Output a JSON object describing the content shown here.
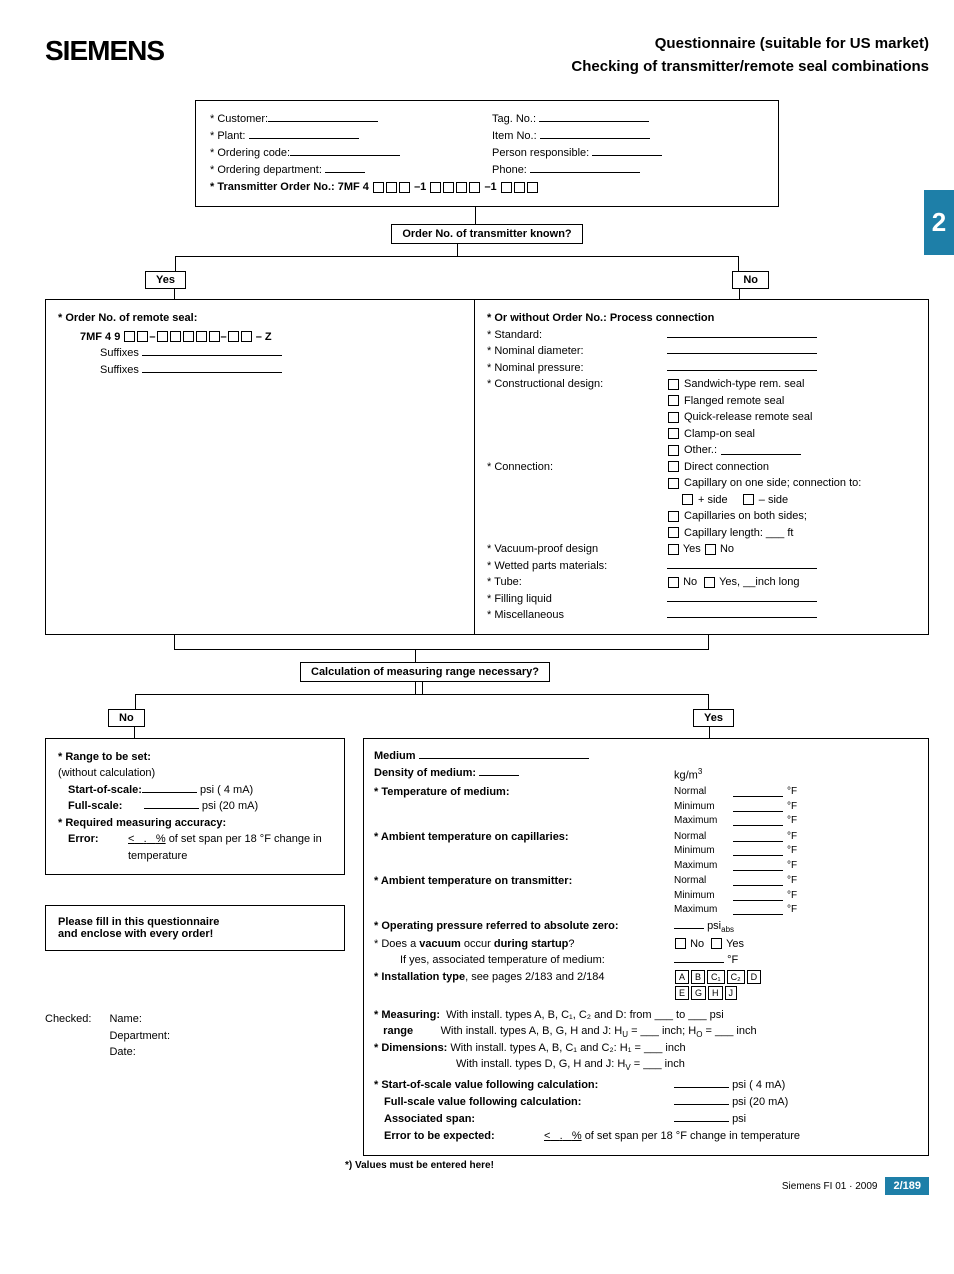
{
  "logo": "SIEMENS",
  "header": {
    "line1": "Questionnaire (suitable for US market)",
    "line2": "Checking of transmitter/remote seal combinations"
  },
  "sidetab": "2",
  "top": {
    "customer": "* Customer:",
    "tagno": "Tag. No.:",
    "plant": "* Plant:",
    "itemno": "Item No.:",
    "ordcode": "* Ordering code:",
    "person": "Person responsible:",
    "orddept": "* Ordering department:",
    "phone": "Phone:",
    "transno": "* Transmitter Order No.:  7MF 4",
    "dash1": "–1",
    "dash1b": "–1"
  },
  "q1": "Order No. of transmitter known?",
  "yes": "Yes",
  "no": "No",
  "left1": {
    "title": "* Order No. of remote seal:",
    "orderno": "7MF 4 9",
    "dashz": "– Z",
    "suffixes": "Suffixes"
  },
  "right1": {
    "title": "*  Or without Order No.: Process connection",
    "standard": "* Standard:",
    "nomdia": "* Nominal diameter:",
    "nompres": "* Nominal pressure:",
    "constr": "* Constructional design:",
    "c1": "Sandwich-type rem. seal",
    "c2": "Flanged remote seal",
    "c3": "Quick-release remote seal",
    "c4": "Clamp-on seal",
    "c5": "Other.:",
    "conn": "* Connection:",
    "cc1": "Direct connection",
    "cc2": "Capillary on one side; connection to:",
    "ccplus": "+ side",
    "ccminus": "– side",
    "cc3": "Capillaries on both sides;",
    "cc4": "Capillary length: ___ ft",
    "vac": "* Vacuum-proof design",
    "vyes": "Yes",
    "vno": "No",
    "wet": "* Wetted parts materials:",
    "tube": "* Tube:",
    "tubeno": "No",
    "tubeyes": "Yes, __inch long",
    "fill": "* Filling liquid",
    "misc": "* Miscellaneous"
  },
  "q2": "Calculation of measuring range necessary?",
  "left2": {
    "range": "* Range to be set:",
    "rangew": "(without calculation)",
    "sos": "Start-of-scale:",
    "sosu": "psi (  4 mA)",
    "fs": "Full-scale:",
    "fsu": "psi (20 mA)",
    "acc": "* Required measuring accuracy:",
    "err": "Error:",
    "erru": "of set span per 18 °F change in temperature",
    "pct": "%",
    "lt": "<",
    "dot": "."
  },
  "enclose": {
    "l1": "Please fill in this questionnaire",
    "l2": "and enclose with every order!"
  },
  "checked": {
    "checked": "Checked:",
    "name": "Name:",
    "dept": "Department:",
    "date": "Date:"
  },
  "right2": {
    "medium": "Medium",
    "density": "Density of medium:",
    "densityu": "kg/m",
    "tempm": "* Temperature of medium:",
    "normal": "Normal",
    "minimum": "Minimum",
    "maximum": "Maximum",
    "degF": "°F",
    "ambc": "* Ambient temperature on capillaries:",
    "ambt": "* Ambient temperature on transmitter:",
    "opp": "* Operating pressure referred to absolute zero:",
    "oppu": "psi",
    "oppabs": "abs",
    "vac": "* Does a vacuum occur during startup?",
    "vacassoc": "If yes, associated temperature of medium:",
    "inst": "* Installation type, see pages 2/183 and 2/184",
    "ibA": "A",
    "ibB": "B",
    "ibC1": "C₁",
    "ibC2": "C₂",
    "ibD": "D",
    "ibE": "E",
    "ibG": "G",
    "ibH": "H",
    "ibJ": "J",
    "meas": "* Measuring: range",
    "meas1": "With install. types A, B, C₁, C₂ and D: from ___ to ___ psi",
    "meas2": "With install. types A, B, G, H and J:  H",
    "meas2u": "U",
    "meas2eq": " = ___ inch; H",
    "meas2o": "O",
    "meas2end": " = ___ inch",
    "dim": "* Dimensions:",
    "dim1": "With install. types A, B, C₁ and C₂:  H₁ = ___ inch",
    "dim2": "With install. types D, G, H and J:     H",
    "dim2v": "V",
    "dim2end": " = ___ inch",
    "sosc": "* Start-of-scale value following calculation:",
    "soscu": "psi (  4 mA)",
    "fsc": "Full-scale value following calculation:",
    "fscu": "psi (20 mA)",
    "asp": "Associated span:",
    "aspu": "psi",
    "erre": "Error to be expected:",
    "erreu": "of set span per 18 °F change in temperature",
    "pct": "%",
    "lt": "<",
    "dot": "."
  },
  "footnote": "*) Values must be entered here!",
  "footer": {
    "catalog": "Siemens FI 01 · 2009",
    "page": "2/189"
  }
}
